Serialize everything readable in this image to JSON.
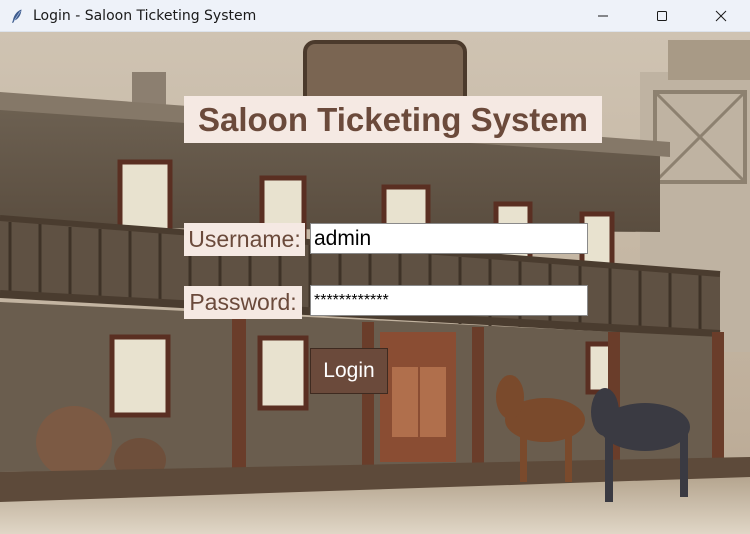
{
  "window": {
    "title": "Login - Saloon Ticketing System",
    "controls": [
      "minimize",
      "maximize",
      "close"
    ]
  },
  "app": {
    "heading": "Saloon Ticketing System"
  },
  "form": {
    "username_label": "Username:",
    "username_value": "admin",
    "password_label": "Password:",
    "password_value": "************",
    "login_label": "Login"
  },
  "colors": {
    "label_background": "#f5e9e3",
    "label_text": "#6b4a3b",
    "button_background": "#6b4a3b",
    "button_text": "#ffffff"
  },
  "background": {
    "description_icon": "western-saloon-image"
  }
}
